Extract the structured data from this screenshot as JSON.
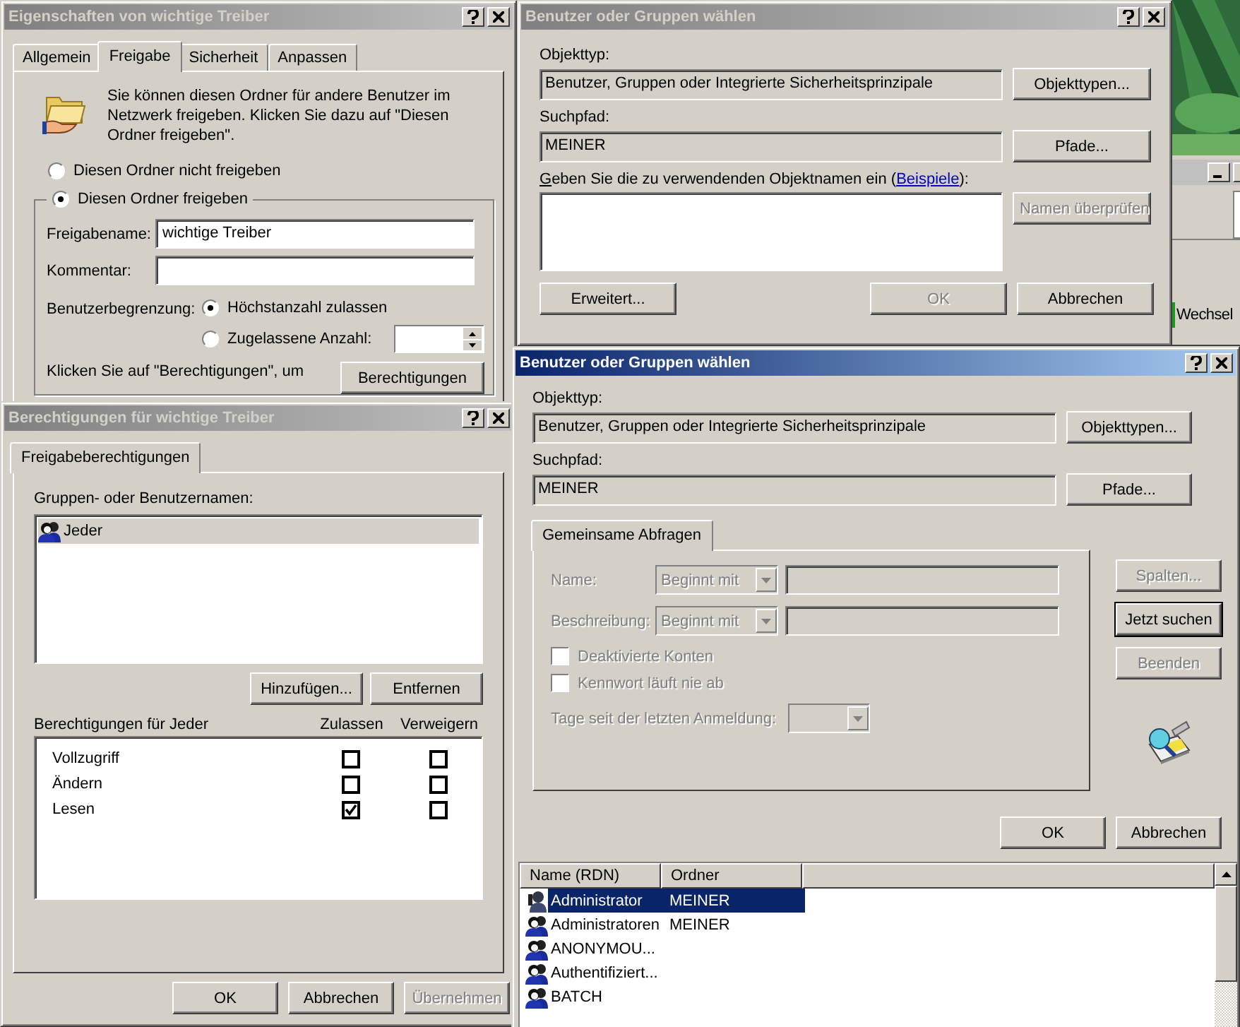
{
  "background_window": {
    "button_label": "Wechsel"
  },
  "properties_dialog": {
    "title": "Eigenschaften von wichtige Treiber",
    "active": false,
    "tabs": [
      {
        "label": "Allgemein",
        "selected": false
      },
      {
        "label": "Freigabe",
        "selected": true
      },
      {
        "label": "Sicherheit",
        "selected": false
      },
      {
        "label": "Anpassen",
        "selected": false
      }
    ],
    "intro": "Sie können diesen Ordner für andere Benutzer im Netzwerk freigeben. Klicken Sie dazu auf \"Diesen Ordner freigeben\".",
    "share_options": [
      {
        "label": "Diesen Ordner nicht freigeben",
        "selected": false
      },
      {
        "label": "Diesen Ordner freigeben",
        "selected": true
      }
    ],
    "fields": [
      {
        "label": "Freigabename:",
        "value": "wichtige Treiber"
      },
      {
        "label": "Kommentar:"
      }
    ],
    "user_limit": {
      "label": "Benutzerbegrenzung:",
      "options": [
        {
          "label": "Höchstanzahl zulassen",
          "selected": true
        },
        {
          "label": "Zugelassene Anzahl:",
          "selected": false
        }
      ]
    },
    "permissions_hint": "Klicken Sie auf \"Berechtigungen\", um",
    "permissions_button": "Berechtigungen"
  },
  "permissions_dialog": {
    "title": "Berechtigungen für wichtige Treiber",
    "active": false,
    "tabs": [
      {
        "label": "Freigabeberechtigungen",
        "selected": true
      }
    ],
    "names_label": "Gruppen- oder Benutzernamen:",
    "names": [
      {
        "name": "Jeder",
        "selected": true
      }
    ],
    "buttons": [
      {
        "label": "Hinzufügen...",
        "disabled": false
      },
      {
        "label": "Entfernen",
        "disabled": false
      }
    ],
    "permissions_label": "Berechtigungen für Jeder",
    "columns": [
      "Zulassen",
      "Verweigern"
    ],
    "permissions": [
      {
        "name": "Vollzugriff",
        "allow": false,
        "deny": false
      },
      {
        "name": "Ändern",
        "allow": false,
        "deny": false
      },
      {
        "name": "Lesen",
        "allow": true,
        "deny": false
      }
    ],
    "footer_buttons": [
      {
        "label": "OK",
        "disabled": false
      },
      {
        "label": "Abbrechen",
        "disabled": false
      },
      {
        "label": "Übernehmen",
        "disabled": true
      }
    ]
  },
  "select_dialog": {
    "title": "Benutzer oder Gruppen wählen",
    "active": false,
    "object_type_label": "Objekttyp:",
    "object_type": "Benutzer, Gruppen oder Integrierte Sicherheitsprinzipale",
    "object_type_button": "Objekttypen...",
    "path_label": "Suchpfad:",
    "path": "MEINER",
    "path_button": "Pfade...",
    "names_prompt": {
      "before": "Geben Sie die zu verwendenden Objektnamen ein (",
      "link": "Beispiele",
      "after": "):"
    },
    "check_button": {
      "label": "Namen überprüfen",
      "disabled": true
    },
    "buttons": [
      {
        "label": "Erweitert...",
        "disabled": false
      },
      {
        "label": "OK",
        "disabled": true
      },
      {
        "label": "Abbrechen",
        "disabled": false
      }
    ]
  },
  "search_dialog": {
    "title": "Benutzer oder Gruppen wählen",
    "active": true,
    "object_type_label": "Objekttyp:",
    "object_type": "Benutzer, Gruppen oder Integrierte Sicherheitsprinzipale",
    "object_type_button": "Objekttypen...",
    "path_label": "Suchpfad:",
    "path": "MEINER",
    "path_button": "Pfade...",
    "tabs": [
      {
        "label": "Gemeinsame Abfragen",
        "selected": true
      }
    ],
    "query_disabled": true,
    "query_rows": [
      {
        "label": "Name:",
        "operator": "Beginnt mit"
      },
      {
        "label": "Beschreibung:",
        "operator": "Beginnt mit"
      }
    ],
    "checkboxes": [
      {
        "label": "Deaktivierte Konten",
        "checked": false
      },
      {
        "label": "Kennwort läuft nie ab",
        "checked": false
      }
    ],
    "days_label": "Tage seit der letzten Anmeldung:",
    "side_buttons": [
      {
        "label": "Spalten...",
        "disabled": true,
        "default": false
      },
      {
        "label": "Jetzt suchen",
        "disabled": false,
        "default": true
      },
      {
        "label": "Beenden",
        "disabled": true,
        "default": false
      }
    ],
    "buttons": [
      {
        "label": "OK",
        "disabled": false
      },
      {
        "label": "Abbrechen",
        "disabled": false
      }
    ],
    "results": {
      "columns": [
        "Name (RDN)",
        "Ordner"
      ],
      "rows": [
        {
          "name": "Administrator",
          "folder": "MEINER",
          "kind": "user",
          "selected": true
        },
        {
          "name": "Administratoren",
          "folder": "MEINER",
          "kind": "group",
          "selected": false
        },
        {
          "name": "ANONYMOU...",
          "kind": "group",
          "selected": false
        },
        {
          "name": "Authentifiziert...",
          "kind": "group",
          "selected": false
        },
        {
          "name": "BATCH",
          "kind": "group",
          "selected": false
        }
      ]
    }
  }
}
